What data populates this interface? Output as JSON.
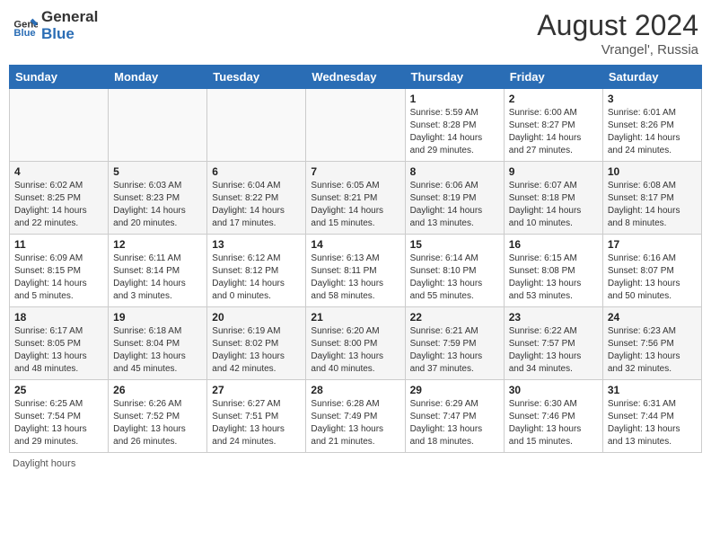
{
  "header": {
    "logo_general": "General",
    "logo_blue": "Blue",
    "month_year": "August 2024",
    "location": "Vrangel', Russia"
  },
  "days_of_week": [
    "Sunday",
    "Monday",
    "Tuesday",
    "Wednesday",
    "Thursday",
    "Friday",
    "Saturday"
  ],
  "footer": {
    "daylight_hours": "Daylight hours"
  },
  "weeks": [
    {
      "days": [
        {
          "num": "",
          "info": "",
          "empty": true
        },
        {
          "num": "",
          "info": "",
          "empty": true
        },
        {
          "num": "",
          "info": "",
          "empty": true
        },
        {
          "num": "",
          "info": "",
          "empty": true
        },
        {
          "num": "1",
          "info": "Sunrise: 5:59 AM\nSunset: 8:28 PM\nDaylight: 14 hours\nand 29 minutes."
        },
        {
          "num": "2",
          "info": "Sunrise: 6:00 AM\nSunset: 8:27 PM\nDaylight: 14 hours\nand 27 minutes."
        },
        {
          "num": "3",
          "info": "Sunrise: 6:01 AM\nSunset: 8:26 PM\nDaylight: 14 hours\nand 24 minutes."
        }
      ]
    },
    {
      "days": [
        {
          "num": "4",
          "info": "Sunrise: 6:02 AM\nSunset: 8:25 PM\nDaylight: 14 hours\nand 22 minutes."
        },
        {
          "num": "5",
          "info": "Sunrise: 6:03 AM\nSunset: 8:23 PM\nDaylight: 14 hours\nand 20 minutes."
        },
        {
          "num": "6",
          "info": "Sunrise: 6:04 AM\nSunset: 8:22 PM\nDaylight: 14 hours\nand 17 minutes."
        },
        {
          "num": "7",
          "info": "Sunrise: 6:05 AM\nSunset: 8:21 PM\nDaylight: 14 hours\nand 15 minutes."
        },
        {
          "num": "8",
          "info": "Sunrise: 6:06 AM\nSunset: 8:19 PM\nDaylight: 14 hours\nand 13 minutes."
        },
        {
          "num": "9",
          "info": "Sunrise: 6:07 AM\nSunset: 8:18 PM\nDaylight: 14 hours\nand 10 minutes."
        },
        {
          "num": "10",
          "info": "Sunrise: 6:08 AM\nSunset: 8:17 PM\nDaylight: 14 hours\nand 8 minutes."
        }
      ]
    },
    {
      "days": [
        {
          "num": "11",
          "info": "Sunrise: 6:09 AM\nSunset: 8:15 PM\nDaylight: 14 hours\nand 5 minutes."
        },
        {
          "num": "12",
          "info": "Sunrise: 6:11 AM\nSunset: 8:14 PM\nDaylight: 14 hours\nand 3 minutes."
        },
        {
          "num": "13",
          "info": "Sunrise: 6:12 AM\nSunset: 8:12 PM\nDaylight: 14 hours\nand 0 minutes."
        },
        {
          "num": "14",
          "info": "Sunrise: 6:13 AM\nSunset: 8:11 PM\nDaylight: 13 hours\nand 58 minutes."
        },
        {
          "num": "15",
          "info": "Sunrise: 6:14 AM\nSunset: 8:10 PM\nDaylight: 13 hours\nand 55 minutes."
        },
        {
          "num": "16",
          "info": "Sunrise: 6:15 AM\nSunset: 8:08 PM\nDaylight: 13 hours\nand 53 minutes."
        },
        {
          "num": "17",
          "info": "Sunrise: 6:16 AM\nSunset: 8:07 PM\nDaylight: 13 hours\nand 50 minutes."
        }
      ]
    },
    {
      "days": [
        {
          "num": "18",
          "info": "Sunrise: 6:17 AM\nSunset: 8:05 PM\nDaylight: 13 hours\nand 48 minutes."
        },
        {
          "num": "19",
          "info": "Sunrise: 6:18 AM\nSunset: 8:04 PM\nDaylight: 13 hours\nand 45 minutes."
        },
        {
          "num": "20",
          "info": "Sunrise: 6:19 AM\nSunset: 8:02 PM\nDaylight: 13 hours\nand 42 minutes."
        },
        {
          "num": "21",
          "info": "Sunrise: 6:20 AM\nSunset: 8:00 PM\nDaylight: 13 hours\nand 40 minutes."
        },
        {
          "num": "22",
          "info": "Sunrise: 6:21 AM\nSunset: 7:59 PM\nDaylight: 13 hours\nand 37 minutes."
        },
        {
          "num": "23",
          "info": "Sunrise: 6:22 AM\nSunset: 7:57 PM\nDaylight: 13 hours\nand 34 minutes."
        },
        {
          "num": "24",
          "info": "Sunrise: 6:23 AM\nSunset: 7:56 PM\nDaylight: 13 hours\nand 32 minutes."
        }
      ]
    },
    {
      "days": [
        {
          "num": "25",
          "info": "Sunrise: 6:25 AM\nSunset: 7:54 PM\nDaylight: 13 hours\nand 29 minutes."
        },
        {
          "num": "26",
          "info": "Sunrise: 6:26 AM\nSunset: 7:52 PM\nDaylight: 13 hours\nand 26 minutes."
        },
        {
          "num": "27",
          "info": "Sunrise: 6:27 AM\nSunset: 7:51 PM\nDaylight: 13 hours\nand 24 minutes."
        },
        {
          "num": "28",
          "info": "Sunrise: 6:28 AM\nSunset: 7:49 PM\nDaylight: 13 hours\nand 21 minutes."
        },
        {
          "num": "29",
          "info": "Sunrise: 6:29 AM\nSunset: 7:47 PM\nDaylight: 13 hours\nand 18 minutes."
        },
        {
          "num": "30",
          "info": "Sunrise: 6:30 AM\nSunset: 7:46 PM\nDaylight: 13 hours\nand 15 minutes."
        },
        {
          "num": "31",
          "info": "Sunrise: 6:31 AM\nSunset: 7:44 PM\nDaylight: 13 hours\nand 13 minutes."
        }
      ]
    }
  ]
}
